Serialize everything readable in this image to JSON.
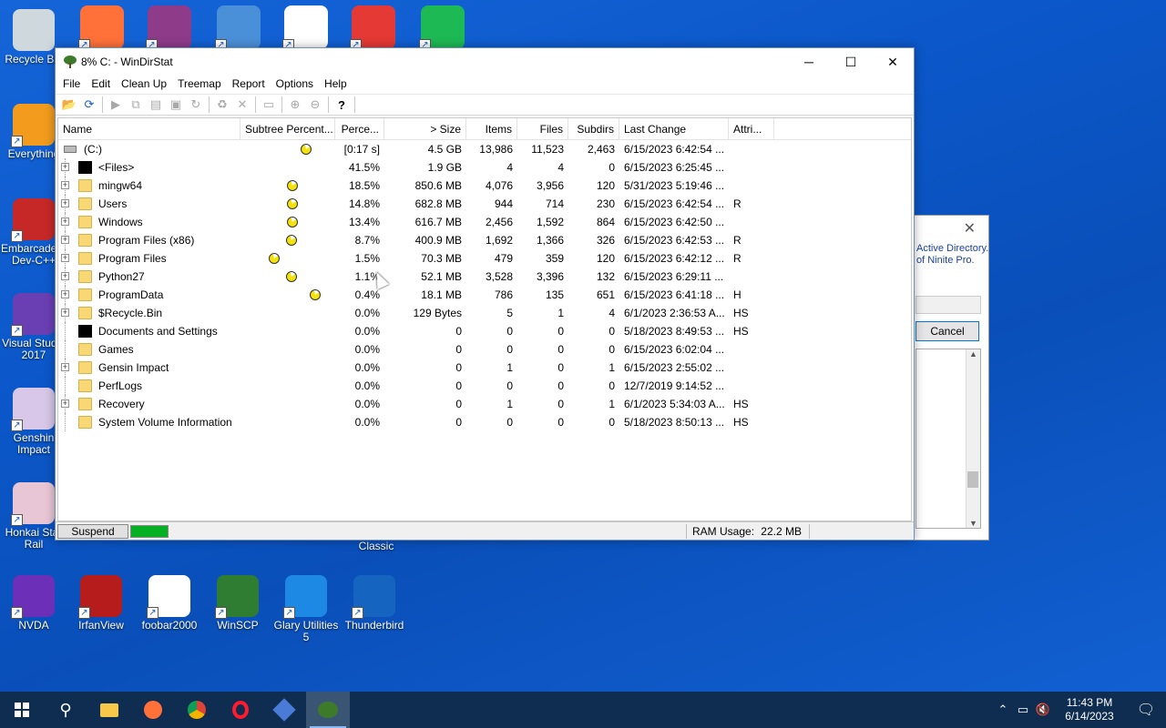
{
  "desktop": {
    "left_icons": [
      {
        "label": "Recycle Bin",
        "color": "#cfd8dc"
      },
      {
        "label": "Everything",
        "color": "#f29b1d"
      },
      {
        "label": "Embarcadero Dev-C++",
        "color": "#c62828"
      },
      {
        "label": "Visual Studio 2017",
        "color": "#6a3fb3"
      },
      {
        "label": "Genshin Impact",
        "color": "#d8c7e8"
      },
      {
        "label": "Honkai Star Rail",
        "color": "#e8c6d6"
      }
    ],
    "bottom_icons": [
      {
        "label": "NVDA",
        "color": "#6b2fb8"
      },
      {
        "label": "IrfanView",
        "color": "#b71c1c"
      },
      {
        "label": "foobar2000",
        "color": "#ffffff"
      },
      {
        "label": "WinSCP",
        "color": "#2e7d32"
      },
      {
        "label": "Glary Utilities 5",
        "color": "#1e88e5"
      },
      {
        "label": "Thunderbird",
        "color": "#1565c0"
      }
    ],
    "top_icons": [
      {
        "name": "firefox",
        "color": "#ff7139"
      },
      {
        "name": "winrar",
        "color": "#8e3b8a"
      },
      {
        "name": "installer",
        "color": "#4a90d9"
      },
      {
        "name": "media-player-classic",
        "color": "#ffffff"
      },
      {
        "name": "gom-player",
        "color": "#e53935"
      },
      {
        "name": "spotify",
        "color": "#1db954"
      }
    ],
    "classic_label": "Classic"
  },
  "bg_dialog": {
    "text_line1": "Active Directory.",
    "text_line2": "of Ninite Pro.",
    "cancel_label": "Cancel"
  },
  "window": {
    "title": "8% C: - WinDirStat",
    "menu": [
      "File",
      "Edit",
      "Clean Up",
      "Treemap",
      "Report",
      "Options",
      "Help"
    ],
    "columns": {
      "name": "Name",
      "subtree": "Subtree Percent...",
      "percent": "Perce...",
      "size": "> Size",
      "items": "Items",
      "files": "Files",
      "subdirs": "Subdirs",
      "last_change": "Last Change",
      "attributes": "Attri..."
    },
    "root": {
      "name": "(C:)",
      "pct": "[0:17 s]",
      "size": "4.5 GB",
      "items": "13,986",
      "files": "11,523",
      "subdirs": "2,463",
      "lc": "6/15/2023  6:42:54 ...",
      "attr": ""
    },
    "rows": [
      {
        "name": "<Files>",
        "pct": "41.5%",
        "size": "1.9 GB",
        "items": "4",
        "files": "4",
        "subdirs": "0",
        "lc": "6/15/2023  6:25:45 ...",
        "attr": "",
        "icon": "black",
        "expand": true,
        "pac": null
      },
      {
        "name": "mingw64",
        "pct": "18.5%",
        "size": "850.6 MB",
        "items": "4,076",
        "files": "3,956",
        "subdirs": "120",
        "lc": "5/31/2023  5:19:46 ...",
        "attr": "",
        "icon": "folder",
        "expand": true,
        "pac": 0.51
      },
      {
        "name": "Users",
        "pct": "14.8%",
        "size": "682.8 MB",
        "items": "944",
        "files": "714",
        "subdirs": "230",
        "lc": "6/15/2023  6:42:54 ...",
        "attr": "R",
        "icon": "folder",
        "expand": true,
        "pac": 0.51
      },
      {
        "name": "Windows",
        "pct": "13.4%",
        "size": "616.7 MB",
        "items": "2,456",
        "files": "1,592",
        "subdirs": "864",
        "lc": "6/15/2023  6:42:50 ...",
        "attr": "",
        "icon": "folder",
        "expand": true,
        "pac": 0.51
      },
      {
        "name": "Program Files (x86)",
        "pct": "8.7%",
        "size": "400.9 MB",
        "items": "1,692",
        "files": "1,366",
        "subdirs": "326",
        "lc": "6/15/2023  6:42:53 ...",
        "attr": "R",
        "icon": "folder",
        "expand": true,
        "pac": 0.5
      },
      {
        "name": "Program Files",
        "pct": "1.5%",
        "size": "70.3 MB",
        "items": "479",
        "files": "359",
        "subdirs": "120",
        "lc": "6/15/2023  6:42:12 ...",
        "attr": "R",
        "icon": "folder",
        "expand": true,
        "pac": 0.31
      },
      {
        "name": "Python27",
        "pct": "1.1%",
        "size": "52.1 MB",
        "items": "3,528",
        "files": "3,396",
        "subdirs": "132",
        "lc": "6/15/2023  6:29:11 ...",
        "attr": "",
        "icon": "folder",
        "expand": true,
        "pac": 0.5
      },
      {
        "name": "ProgramData",
        "pct": "0.4%",
        "size": "18.1 MB",
        "items": "786",
        "files": "135",
        "subdirs": "651",
        "lc": "6/15/2023  6:41:18 ...",
        "attr": "H",
        "icon": "folder",
        "expand": true,
        "pac": 0.76
      },
      {
        "name": "$Recycle.Bin",
        "pct": "0.0%",
        "size": "129 Bytes",
        "items": "5",
        "files": "1",
        "subdirs": "4",
        "lc": "6/1/2023  2:36:53 A...",
        "attr": "HS",
        "icon": "folder",
        "expand": true,
        "pac": null
      },
      {
        "name": "Documents and Settings",
        "pct": "0.0%",
        "size": "0",
        "items": "0",
        "files": "0",
        "subdirs": "0",
        "lc": "5/18/2023  8:49:53 ...",
        "attr": "HS",
        "icon": "black",
        "expand": false,
        "pac": null
      },
      {
        "name": "Games",
        "pct": "0.0%",
        "size": "0",
        "items": "0",
        "files": "0",
        "subdirs": "0",
        "lc": "6/15/2023  6:02:04 ...",
        "attr": "",
        "icon": "folder",
        "expand": false,
        "pac": null
      },
      {
        "name": "Gensin Impact",
        "pct": "0.0%",
        "size": "0",
        "items": "1",
        "files": "0",
        "subdirs": "1",
        "lc": "6/15/2023  2:55:02 ...",
        "attr": "",
        "icon": "folder",
        "expand": true,
        "pac": null
      },
      {
        "name": "PerfLogs",
        "pct": "0.0%",
        "size": "0",
        "items": "0",
        "files": "0",
        "subdirs": "0",
        "lc": "12/7/2019  9:14:52 ...",
        "attr": "",
        "icon": "folder",
        "expand": false,
        "pac": null
      },
      {
        "name": "Recovery",
        "pct": "0.0%",
        "size": "0",
        "items": "1",
        "files": "0",
        "subdirs": "1",
        "lc": "6/1/2023  5:34:03 A...",
        "attr": "HS",
        "icon": "folder",
        "expand": true,
        "pac": null
      },
      {
        "name": "System Volume Information",
        "pct": "0.0%",
        "size": "0",
        "items": "0",
        "files": "0",
        "subdirs": "0",
        "lc": "5/18/2023  8:50:13 ...",
        "attr": "HS",
        "icon": "folder",
        "expand": false,
        "pac": null
      }
    ],
    "status": {
      "suspend_label": "Suspend",
      "ram_label": "RAM Usage:",
      "ram_value": "22.2 MB"
    }
  },
  "taskbar": {
    "time": "11:43 PM",
    "date": "6/14/2023"
  }
}
